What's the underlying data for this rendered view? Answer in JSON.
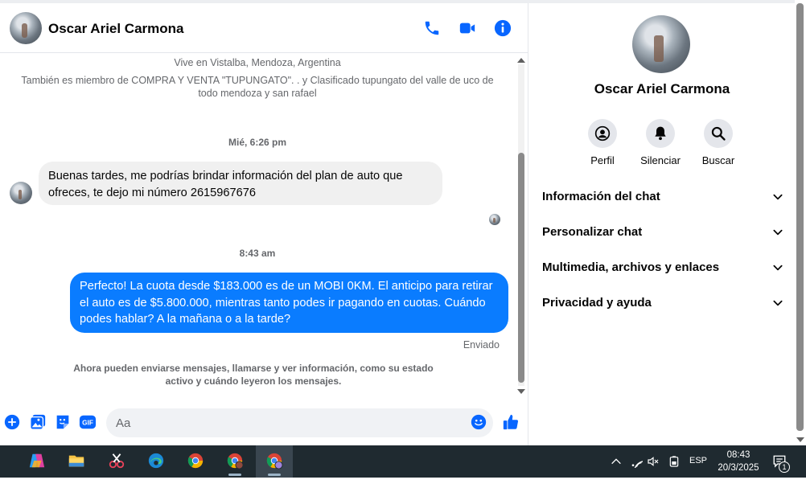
{
  "header": {
    "contact_name": "Oscar Ariel Carmona",
    "icons": [
      "phone-icon",
      "video-camera-icon",
      "info-icon"
    ]
  },
  "messages": {
    "location": "Vive en Vistalba, Mendoza, Argentina",
    "groups": "También es miembro de COMPRA Y VENTA \"TUPUNGATO\". . y Clasificado tupungato del valle de uco de todo mendoza y san rafael",
    "timestamp_1": "Mié, 6:26 pm",
    "incoming_text": "Buenas tardes, me podrías brindar información del plan de auto que ofreces,  te dejo mi número 2615967676",
    "timestamp_2": "8:43 am",
    "outgoing_text": "Perfecto! La cuota desde $183.000 es de un MOBI 0KM. El anticipo para retirar el auto es de $5.800.000, mientras tanto podes ir pagando en cuotas. Cuándo podes hablar? A la mañana o a la tarde?",
    "sent_status": "Enviado",
    "info_notice": "Ahora pueden enviarse mensajes, llamarse y ver información, como su estado activo y cuándo leyeron los mensajes."
  },
  "composer": {
    "placeholder": "Aa",
    "icons": [
      "plus-icon",
      "photo-icon",
      "sticker-icon",
      "gif-icon",
      "emoji-icon",
      "like-icon"
    ],
    "gif_label": "GIF"
  },
  "side": {
    "name": "Oscar Ariel Carmona",
    "actions": [
      {
        "label": "Perfil",
        "icon": "profile-icon"
      },
      {
        "label": "Silenciar",
        "icon": "bell-icon"
      },
      {
        "label": "Buscar",
        "icon": "search-icon"
      }
    ],
    "sections": [
      "Información del chat",
      "Personalizar chat",
      "Multimedia, archivos y enlaces",
      "Privacidad y ayuda"
    ]
  },
  "taskbar": {
    "apps": [
      "copilot-icon",
      "file-explorer-icon",
      "snipping-tool-icon",
      "edge-icon",
      "chrome-icon",
      "chrome-profile-icon",
      "chrome-profile-2-icon"
    ],
    "language": "ESP",
    "time": "08:43",
    "date": "20/3/2025",
    "notification_count": "1"
  },
  "colors": {
    "accent": "#0a7cff",
    "icon_blue": "#0866ff",
    "taskbar": "#1f2a30"
  }
}
